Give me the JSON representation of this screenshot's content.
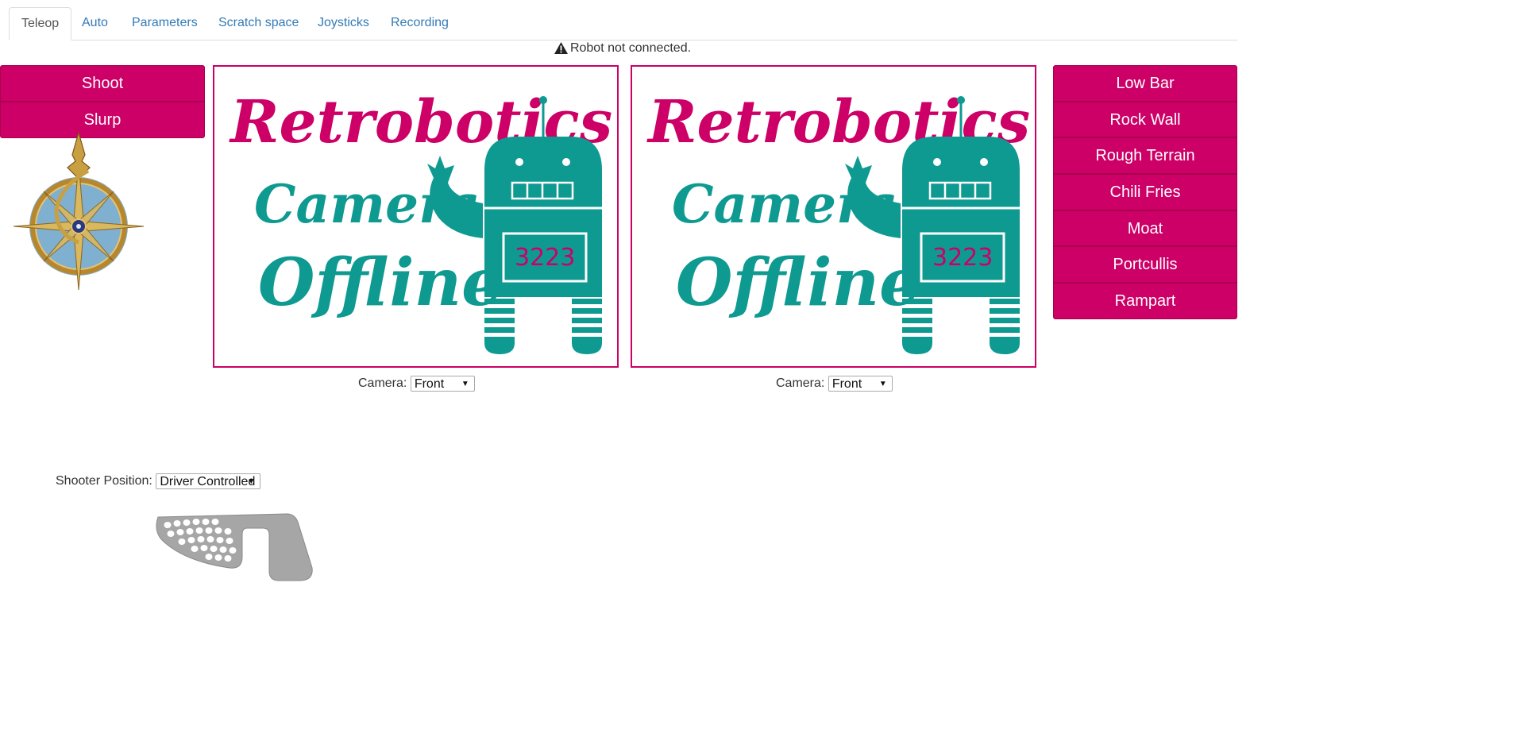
{
  "tabs": [
    {
      "label": "Teleop",
      "active": true
    },
    {
      "label": "Auto"
    },
    {
      "label": "Parameters"
    },
    {
      "label": "Scratch space"
    },
    {
      "label": "Joysticks"
    },
    {
      "label": "Recording"
    }
  ],
  "status": {
    "text": "Robot not connected.",
    "icon": "warning-icon"
  },
  "left_buttons": [
    "Shoot",
    "Slurp"
  ],
  "right_buttons": [
    "Low Bar",
    "Rock Wall",
    "Rough Terrain",
    "Chili Fries",
    "Moat",
    "Portcullis",
    "Rampart"
  ],
  "camera_placeholder": {
    "line1": "Retrobotics",
    "line2": "Camera",
    "line3": "Offline",
    "team_number": "3223"
  },
  "cameras": [
    {
      "label": "Camera:",
      "selected": "Front"
    },
    {
      "label": "Camera:",
      "selected": "Front"
    }
  ],
  "shooter": {
    "label": "Shooter Position:",
    "selected": "Driver Controlled"
  },
  "colors": {
    "accent": "#cc0066",
    "teal": "#0e9a91",
    "link": "#337ab7"
  }
}
